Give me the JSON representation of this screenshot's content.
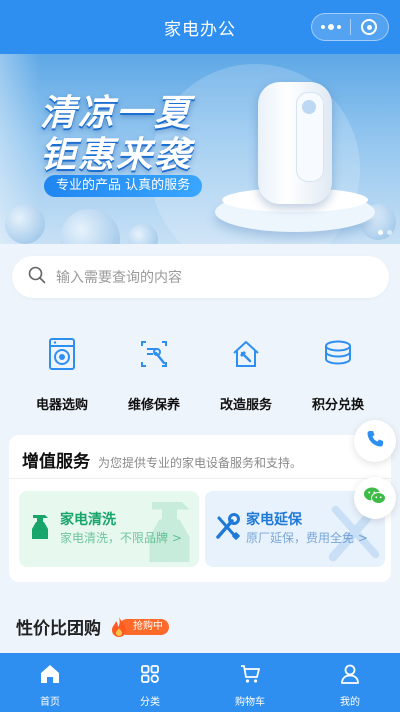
{
  "header": {
    "title": "家电办公"
  },
  "banner": {
    "headline_1": "清凉一夏",
    "headline_2": "钜惠来袭",
    "tagline": "专业的产品 认真的服务"
  },
  "search": {
    "placeholder": "输入需要查询的内容"
  },
  "categories": [
    {
      "label": "电器选购",
      "icon": "washing-machine-icon"
    },
    {
      "label": "维修保养",
      "icon": "repair-tools-icon"
    },
    {
      "label": "改造服务",
      "icon": "house-hammer-icon"
    },
    {
      "label": "积分兑换",
      "icon": "coins-stack-icon"
    }
  ],
  "value_added": {
    "title": "增值服务",
    "subtitle": "为您提供专业的家电设备服务和支持。",
    "tiles": [
      {
        "title": "家电清洗",
        "desc": "家电清洗，不限品牌 >",
        "icon": "spray-bottle-icon",
        "color": "#17a56b"
      },
      {
        "title": "家电延保",
        "desc": "原厂延保，费用全免 >",
        "icon": "wrench-screwdriver-icon",
        "color": "#1f79d6"
      }
    ]
  },
  "group_buy": {
    "title": "性价比团购",
    "badge": "抢购中"
  },
  "tabbar": [
    {
      "label": "首页",
      "icon": "home-icon"
    },
    {
      "label": "分类",
      "icon": "category-grid-icon"
    },
    {
      "label": "购物车",
      "icon": "cart-icon"
    },
    {
      "label": "我的",
      "icon": "user-icon"
    }
  ],
  "colors": {
    "primary": "#2f8ff0",
    "page_bg": "#eef4fb",
    "green": "#17a56b",
    "orange": "#ff6a2a"
  }
}
